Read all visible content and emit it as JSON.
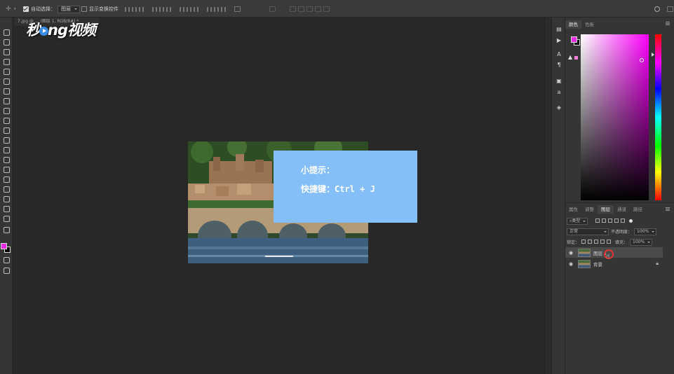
{
  "options_bar": {
    "auto_select_label": "自动选择：",
    "auto_select_value": "图层",
    "show_transform_label": "显示变换控件"
  },
  "document": {
    "tab_title": "7.jpg @ ... (图层 1, RGB/8#) *"
  },
  "watermark": {
    "text_before": "秒",
    "text_after": "ng视频",
    "letter": "d"
  },
  "tip": {
    "line1": "小提示：",
    "line2": "快捷键：Ctrl + J"
  },
  "color_panel": {
    "tabs": [
      "颜色",
      "色板"
    ],
    "foreground_color": "#ea28e6",
    "background_color": "#000000"
  },
  "layers_panel": {
    "tabs": [
      "属性",
      "调整",
      "图层",
      "通道",
      "路径"
    ],
    "active_tab": "图层",
    "filter_label": "类型",
    "blend_mode": "正常",
    "opacity_label": "不透明度：",
    "opacity_value": "100%",
    "lock_label": "锁定：",
    "fill_label": "填充：",
    "fill_value": "100%",
    "layers": [
      {
        "name": "图层 1",
        "active": true
      },
      {
        "name": "背景",
        "active": false
      }
    ]
  }
}
